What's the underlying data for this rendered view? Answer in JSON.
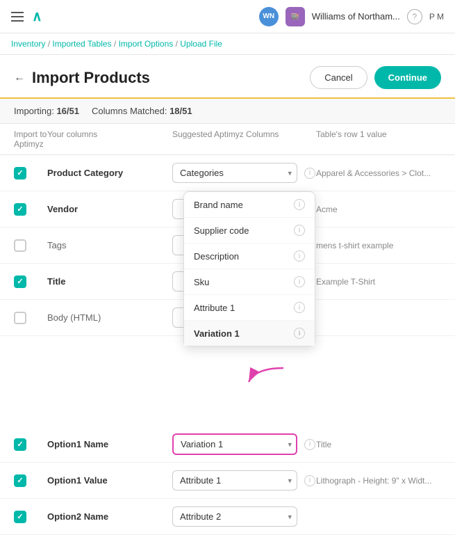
{
  "topbar": {
    "logo": "∧",
    "avatar": "WN",
    "shop_badge": "🏠",
    "store_name": "Williams of Northam...",
    "help": "?",
    "user_initials": "P M"
  },
  "breadcrumb": {
    "items": [
      "Inventory",
      "Imported Tables",
      "Import Options"
    ],
    "current": "Upload File"
  },
  "header": {
    "back": "←",
    "title": "Import Products",
    "cancel_label": "Cancel",
    "continue_label": "Continue"
  },
  "summary": {
    "importing_label": "Importing:",
    "importing_value": "16/51",
    "matched_label": "Columns Matched:",
    "matched_value": "18/51"
  },
  "columns": {
    "col1": "Import to Aptimyz",
    "col2": "Your columns",
    "col3": "Suggested Aptimyz Columns",
    "col4": "Table's row 1 value"
  },
  "rows": [
    {
      "checked": true,
      "label": "Product Category",
      "select_value": "Categories",
      "select_highlighted": false,
      "row_value": "Apparel & Accessories > Clot...",
      "has_info": true
    },
    {
      "checked": true,
      "label": "Vendor",
      "select_value": "",
      "select_highlighted": false,
      "row_value": "Acme",
      "has_info": true
    },
    {
      "checked": false,
      "label": "Tags",
      "select_value": "",
      "select_highlighted": false,
      "row_value": "mens t-shirt example",
      "has_info": false
    },
    {
      "checked": true,
      "label": "Title",
      "select_value": "",
      "select_highlighted": false,
      "row_value": "Example T-Shirt",
      "has_info": true
    },
    {
      "checked": false,
      "label": "Body (HTML)",
      "select_value": "",
      "select_highlighted": false,
      "row_value": "",
      "has_info": false
    },
    {
      "checked": true,
      "label": "Option1 Name",
      "select_value": "Variation 1",
      "select_highlighted": true,
      "row_value": "Title",
      "has_info": true
    },
    {
      "checked": true,
      "label": "Option1 Value",
      "select_value": "Attribute 1",
      "select_highlighted": false,
      "row_value": "Lithograph - Height: 9\" x Widt...",
      "has_info": true
    },
    {
      "checked": true,
      "label": "Option2 Name",
      "select_value": "Attribute 2",
      "select_highlighted": false,
      "row_value": "",
      "has_info": false
    }
  ],
  "dropdown": {
    "items": [
      {
        "label": "Brand name",
        "has_info": true
      },
      {
        "label": "Supplier code",
        "has_info": true
      },
      {
        "label": "Description",
        "has_info": true
      },
      {
        "label": "Sku",
        "has_info": true
      },
      {
        "label": "Attribute 1",
        "has_info": true
      },
      {
        "label": "Variation 1",
        "has_info": true,
        "active": true
      }
    ]
  }
}
